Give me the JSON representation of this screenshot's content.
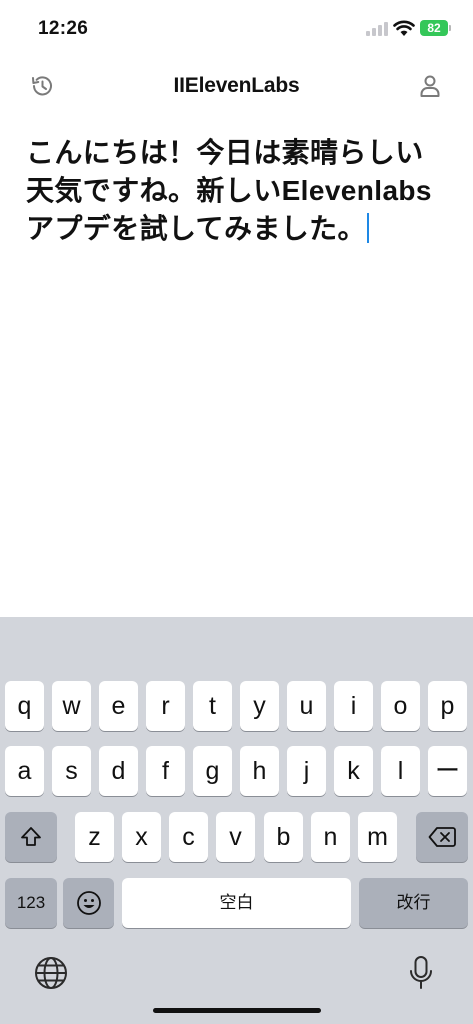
{
  "status_bar": {
    "time": "12:26",
    "battery": "82"
  },
  "header": {
    "title": "IIElevenLabs"
  },
  "editor": {
    "text": "こんにちは！今日は素晴らしい天気ですね。新しいElevenlabsアプデを試してみました。"
  },
  "keyboard": {
    "row1": [
      "q",
      "w",
      "e",
      "r",
      "t",
      "y",
      "u",
      "i",
      "o",
      "p"
    ],
    "row2": [
      "a",
      "s",
      "d",
      "f",
      "g",
      "h",
      "j",
      "k",
      "l",
      "ー"
    ],
    "row3": [
      "z",
      "x",
      "c",
      "v",
      "b",
      "n",
      "m"
    ],
    "numbers_label": "123",
    "space_label": "空白",
    "return_label": "改行"
  },
  "colors": {
    "caret": "#1e88e5",
    "battery": "#34c759",
    "keyboard_bg": "#d2d5db"
  },
  "icons": [
    "history-icon",
    "profile-icon",
    "shift-icon",
    "delete-icon",
    "emoji-icon",
    "globe-icon",
    "mic-icon",
    "wifi-icon",
    "signal-icon"
  ]
}
